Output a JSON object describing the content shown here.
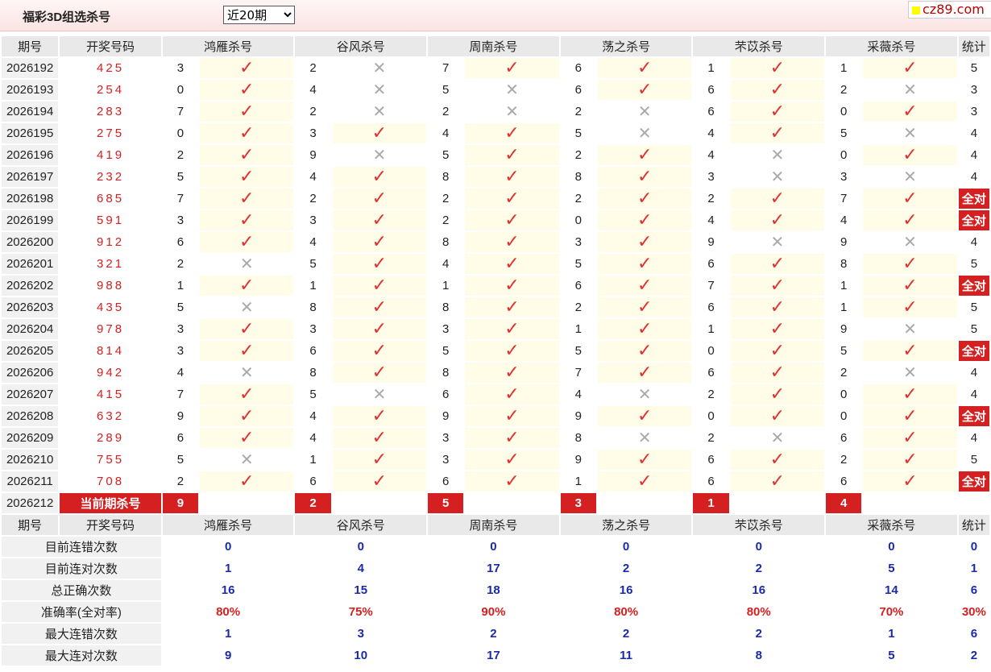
{
  "header": {
    "title": "福彩3D组选杀号",
    "period_select": "近20期",
    "logo_text": "cz89.com"
  },
  "columns": {
    "period": "期号",
    "draw": "开奖号码",
    "stat": "统计",
    "experts": [
      "鸿雁杀号",
      "谷风杀号",
      "周南杀号",
      "荡之杀号",
      "芣苡杀号",
      "采薇杀号"
    ]
  },
  "full_label": "全对",
  "rows": [
    {
      "period": "2026192",
      "draw": "425",
      "k": [
        [
          "3",
          1
        ],
        [
          "2",
          0
        ],
        [
          "7",
          1
        ],
        [
          "6",
          1
        ],
        [
          "1",
          1
        ],
        [
          "1",
          1
        ]
      ],
      "stat": "5"
    },
    {
      "period": "2026193",
      "draw": "254",
      "k": [
        [
          "0",
          1
        ],
        [
          "4",
          0
        ],
        [
          "5",
          0
        ],
        [
          "6",
          1
        ],
        [
          "6",
          1
        ],
        [
          "2",
          0
        ]
      ],
      "stat": "3"
    },
    {
      "period": "2026194",
      "draw": "283",
      "k": [
        [
          "7",
          1
        ],
        [
          "2",
          0
        ],
        [
          "2",
          0
        ],
        [
          "2",
          0
        ],
        [
          "6",
          1
        ],
        [
          "0",
          1
        ]
      ],
      "stat": "3"
    },
    {
      "period": "2026195",
      "draw": "275",
      "k": [
        [
          "0",
          1
        ],
        [
          "3",
          1
        ],
        [
          "4",
          1
        ],
        [
          "5",
          0
        ],
        [
          "4",
          1
        ],
        [
          "5",
          0
        ]
      ],
      "stat": "4"
    },
    {
      "period": "2026196",
      "draw": "419",
      "k": [
        [
          "2",
          1
        ],
        [
          "9",
          0
        ],
        [
          "5",
          1
        ],
        [
          "2",
          1
        ],
        [
          "4",
          0
        ],
        [
          "0",
          1
        ]
      ],
      "stat": "4"
    },
    {
      "period": "2026197",
      "draw": "232",
      "k": [
        [
          "5",
          1
        ],
        [
          "4",
          1
        ],
        [
          "8",
          1
        ],
        [
          "8",
          1
        ],
        [
          "3",
          0
        ],
        [
          "3",
          0
        ]
      ],
      "stat": "4"
    },
    {
      "period": "2026198",
      "draw": "685",
      "k": [
        [
          "7",
          1
        ],
        [
          "2",
          1
        ],
        [
          "2",
          1
        ],
        [
          "2",
          1
        ],
        [
          "2",
          1
        ],
        [
          "7",
          1
        ]
      ],
      "stat": "全对"
    },
    {
      "period": "2026199",
      "draw": "591",
      "k": [
        [
          "3",
          1
        ],
        [
          "3",
          1
        ],
        [
          "2",
          1
        ],
        [
          "0",
          1
        ],
        [
          "4",
          1
        ],
        [
          "4",
          1
        ]
      ],
      "stat": "全对"
    },
    {
      "period": "2026200",
      "draw": "912",
      "k": [
        [
          "6",
          1
        ],
        [
          "4",
          1
        ],
        [
          "8",
          1
        ],
        [
          "3",
          1
        ],
        [
          "9",
          0
        ],
        [
          "9",
          0
        ]
      ],
      "stat": "4"
    },
    {
      "period": "2026201",
      "draw": "321",
      "k": [
        [
          "2",
          0
        ],
        [
          "5",
          1
        ],
        [
          "4",
          1
        ],
        [
          "5",
          1
        ],
        [
          "6",
          1
        ],
        [
          "8",
          1
        ]
      ],
      "stat": "5"
    },
    {
      "period": "2026202",
      "draw": "988",
      "k": [
        [
          "1",
          1
        ],
        [
          "1",
          1
        ],
        [
          "1",
          1
        ],
        [
          "6",
          1
        ],
        [
          "7",
          1
        ],
        [
          "1",
          1
        ]
      ],
      "stat": "全对"
    },
    {
      "period": "2026203",
      "draw": "435",
      "k": [
        [
          "5",
          0
        ],
        [
          "8",
          1
        ],
        [
          "8",
          1
        ],
        [
          "2",
          1
        ],
        [
          "6",
          1
        ],
        [
          "1",
          1
        ]
      ],
      "stat": "5"
    },
    {
      "period": "2026204",
      "draw": "978",
      "k": [
        [
          "3",
          1
        ],
        [
          "3",
          1
        ],
        [
          "3",
          1
        ],
        [
          "1",
          1
        ],
        [
          "1",
          1
        ],
        [
          "9",
          0
        ]
      ],
      "stat": "5"
    },
    {
      "period": "2026205",
      "draw": "814",
      "k": [
        [
          "3",
          1
        ],
        [
          "6",
          1
        ],
        [
          "5",
          1
        ],
        [
          "5",
          1
        ],
        [
          "0",
          1
        ],
        [
          "5",
          1
        ]
      ],
      "stat": "全对"
    },
    {
      "period": "2026206",
      "draw": "942",
      "k": [
        [
          "4",
          0
        ],
        [
          "8",
          1
        ],
        [
          "8",
          1
        ],
        [
          "7",
          1
        ],
        [
          "6",
          1
        ],
        [
          "2",
          0
        ]
      ],
      "stat": "4"
    },
    {
      "period": "2026207",
      "draw": "415",
      "k": [
        [
          "7",
          1
        ],
        [
          "5",
          0
        ],
        [
          "6",
          1
        ],
        [
          "4",
          0
        ],
        [
          "2",
          1
        ],
        [
          "0",
          1
        ]
      ],
      "stat": "4"
    },
    {
      "period": "2026208",
      "draw": "632",
      "k": [
        [
          "9",
          1
        ],
        [
          "4",
          1
        ],
        [
          "9",
          1
        ],
        [
          "9",
          1
        ],
        [
          "0",
          1
        ],
        [
          "0",
          1
        ]
      ],
      "stat": "全对"
    },
    {
      "period": "2026209",
      "draw": "289",
      "k": [
        [
          "6",
          1
        ],
        [
          "4",
          1
        ],
        [
          "3",
          1
        ],
        [
          "8",
          0
        ],
        [
          "2",
          0
        ],
        [
          "6",
          1
        ]
      ],
      "stat": "4"
    },
    {
      "period": "2026210",
      "draw": "755",
      "k": [
        [
          "5",
          0
        ],
        [
          "1",
          1
        ],
        [
          "3",
          1
        ],
        [
          "9",
          1
        ],
        [
          "6",
          1
        ],
        [
          "2",
          1
        ]
      ],
      "stat": "5"
    },
    {
      "period": "2026211",
      "draw": "708",
      "k": [
        [
          "2",
          1
        ],
        [
          "6",
          1
        ],
        [
          "6",
          1
        ],
        [
          "1",
          1
        ],
        [
          "6",
          1
        ],
        [
          "6",
          1
        ]
      ],
      "stat": "全对"
    }
  ],
  "current": {
    "period": "2026212",
    "label": "当前期杀号",
    "kills": [
      "9",
      "2",
      "5",
      "3",
      "1",
      "4"
    ]
  },
  "summary": [
    {
      "label": "目前连错次数",
      "values": [
        "0",
        "0",
        "0",
        "0",
        "0",
        "0"
      ],
      "stat": "0",
      "red": false
    },
    {
      "label": "目前连对次数",
      "values": [
        "1",
        "4",
        "17",
        "2",
        "2",
        "5"
      ],
      "stat": "1",
      "red": false
    },
    {
      "label": "总正确次数",
      "values": [
        "16",
        "15",
        "18",
        "16",
        "16",
        "14"
      ],
      "stat": "6",
      "red": false
    },
    {
      "label": "准确率(全对率)",
      "values": [
        "80%",
        "75%",
        "90%",
        "80%",
        "80%",
        "70%"
      ],
      "stat": "30%",
      "red": true
    },
    {
      "label": "最大连错次数",
      "values": [
        "1",
        "3",
        "2",
        "2",
        "2",
        "1"
      ],
      "stat": "6",
      "red": false
    },
    {
      "label": "最大连对次数",
      "values": [
        "9",
        "10",
        "17",
        "11",
        "8",
        "5"
      ],
      "stat": "2",
      "red": false
    }
  ]
}
